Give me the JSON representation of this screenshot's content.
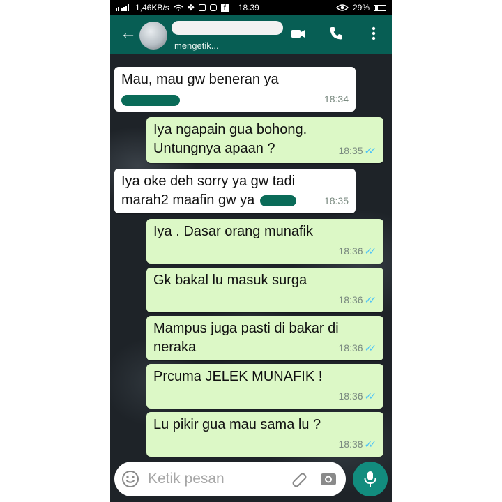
{
  "status_bar": {
    "network": "1,46KB/s",
    "time": "18.39",
    "battery": "29%"
  },
  "header": {
    "status": "mengetik..."
  },
  "messages": [
    {
      "dir": "in",
      "line1": "Mau, mau gw beneran ya",
      "line2": "",
      "time": "18:34"
    },
    {
      "dir": "out",
      "line1": "Iya ngapain gua bohong.",
      "line2": "Untungnya apaan ?",
      "time": "18:35"
    },
    {
      "dir": "in",
      "line1": "Iya oke deh sorry ya gw tadi",
      "line2": "marah2 maafin gw ya",
      "time": "18:35"
    },
    {
      "dir": "out",
      "line1": "Iya . Dasar orang munafik",
      "line2": "",
      "time": "18:36"
    },
    {
      "dir": "out",
      "line1": "Gk bakal lu masuk surga",
      "line2": "",
      "time": "18:36"
    },
    {
      "dir": "out",
      "line1": "Mampus juga pasti di bakar di",
      "line2": "neraka",
      "time": "18:36"
    },
    {
      "dir": "out",
      "line1": "Prcuma JELEK MUNAFIK !",
      "line2": "",
      "time": "18:36"
    },
    {
      "dir": "out",
      "line1": "Lu pikir gua mau sama lu ?",
      "line2": "",
      "time": "18:38"
    }
  ],
  "composer": {
    "placeholder": "Ketik pesan"
  },
  "icons": {
    "back": "arrow-left-icon",
    "video": "video-call-icon",
    "call": "phone-call-icon",
    "menu": "more-vert-icon",
    "emoji": "emoji-icon",
    "attach": "paperclip-icon",
    "camera": "camera-icon",
    "mic": "mic-icon"
  },
  "colors": {
    "header": "#075e54",
    "outgoing_bubble": "#dcf8c6",
    "incoming_bubble": "#ffffff",
    "read_ticks": "#4fc3f7",
    "mic_button": "#128c7e"
  }
}
